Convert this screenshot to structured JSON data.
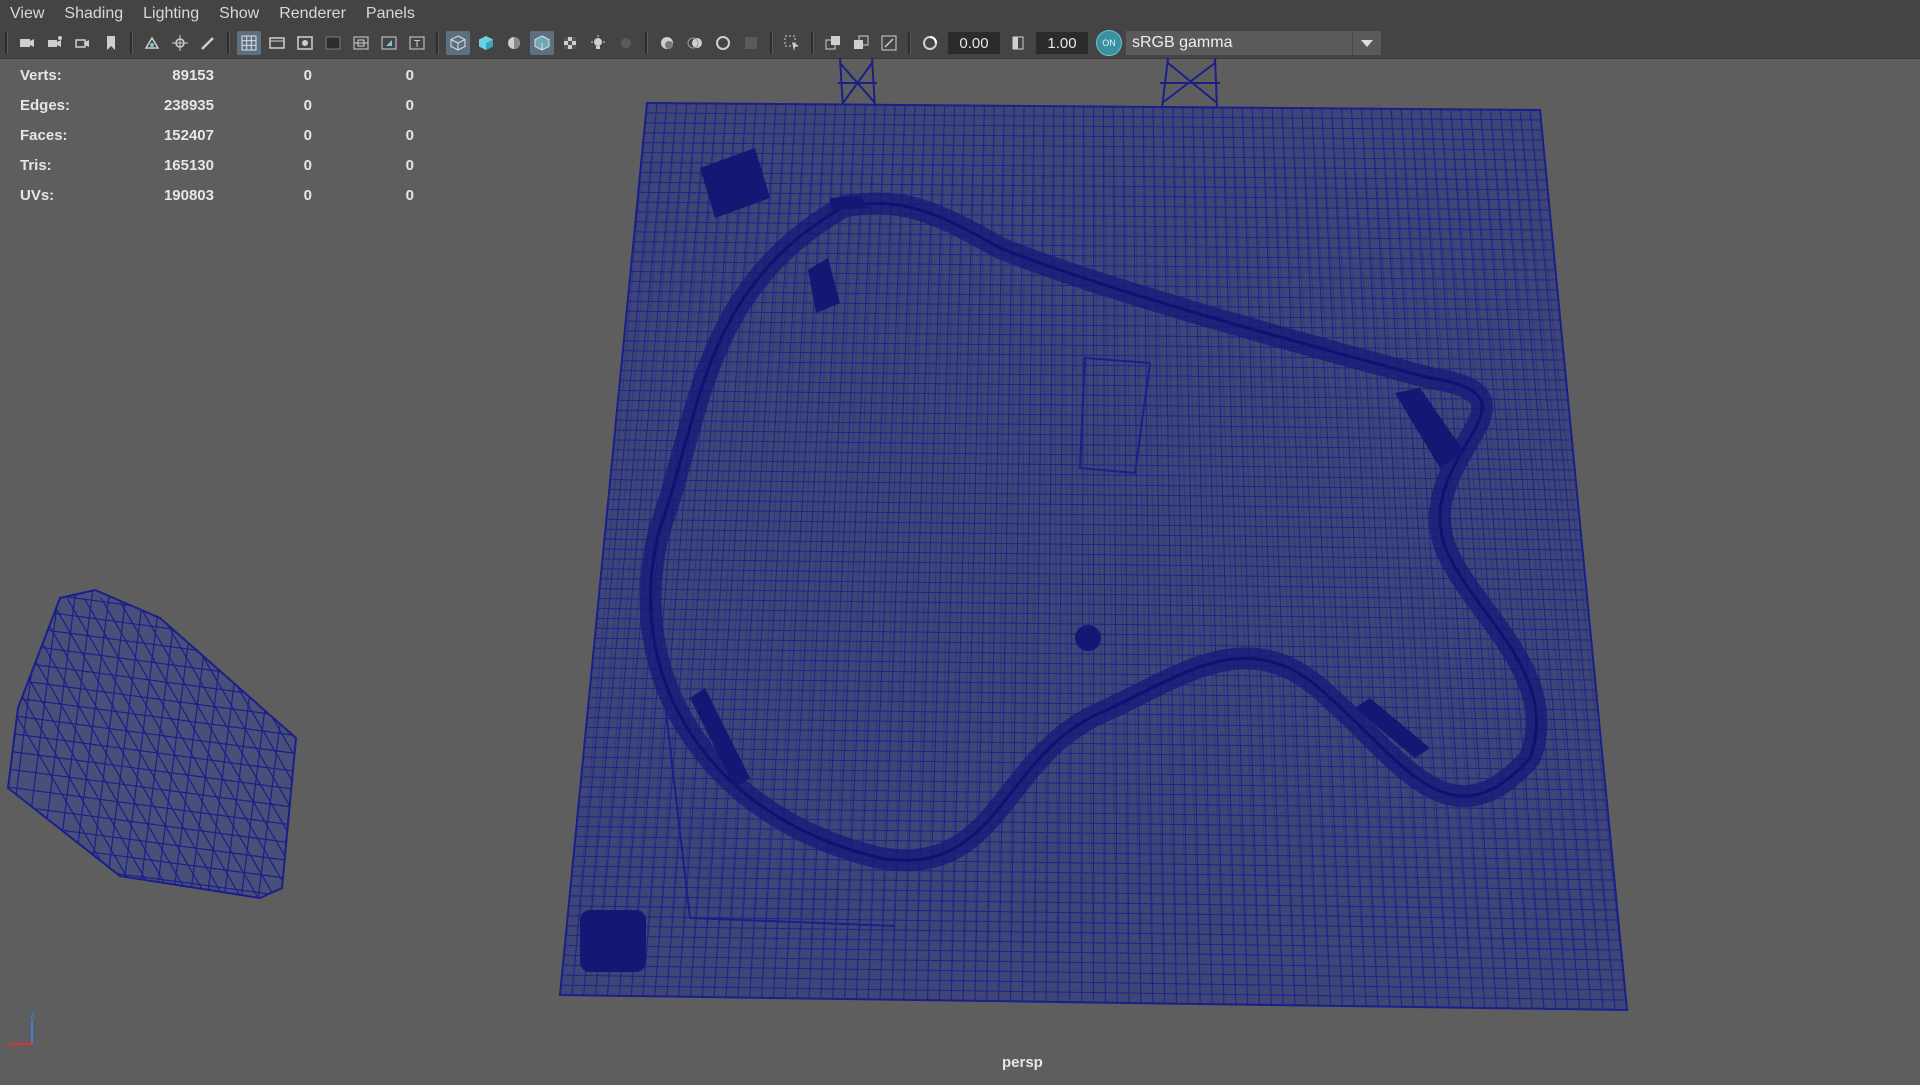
{
  "menu": [
    "View",
    "Shading",
    "Lighting",
    "Show",
    "Renderer",
    "Panels"
  ],
  "toolbar": {
    "exposure": "0.00",
    "gamma": "1.00",
    "cm_badge": "ON",
    "color_space": "sRGB gamma"
  },
  "hud": {
    "rows": [
      {
        "label": "Verts:",
        "v": "89153",
        "s": "0",
        "u": "0"
      },
      {
        "label": "Edges:",
        "v": "238935",
        "s": "0",
        "u": "0"
      },
      {
        "label": "Faces:",
        "v": "152407",
        "s": "0",
        "u": "0"
      },
      {
        "label": "Tris:",
        "v": "165130",
        "s": "0",
        "u": "0"
      },
      {
        "label": "UVs:",
        "v": "190803",
        "s": "0",
        "u": "0"
      }
    ]
  },
  "viewport": {
    "camera": "persp",
    "wire_color": "#1a1f8a",
    "background": "#5e5e5e"
  },
  "axis": {
    "x": "x",
    "z": "z"
  },
  "icons": [
    "camera-icon",
    "camera-attributes-icon",
    "camera-select-icon",
    "bookmark-icon",
    "image-plane-icon",
    "2d-pan-zoom-icon",
    "grease-pencil-icon",
    "grid-icon",
    "film-gate-icon",
    "resolution-gate-icon",
    "gate-mask-icon",
    "field-chart-icon",
    "safe-action-icon",
    "safe-title-icon",
    "wireframe-icon",
    "smooth-shade-icon",
    "default-material-icon",
    "wireframe-on-shaded-icon",
    "textured-icon",
    "lights-icon",
    "shadows-icon",
    "screen-space-ao-icon",
    "motion-blur-icon",
    "antialiasing-icon",
    "depth-of-field-icon",
    "xray-icon",
    "isolate-select-icon",
    "xray-joints-icon",
    "xray-components-icon",
    "exposure-icon",
    "gamma-icon",
    "color-management-icon"
  ]
}
